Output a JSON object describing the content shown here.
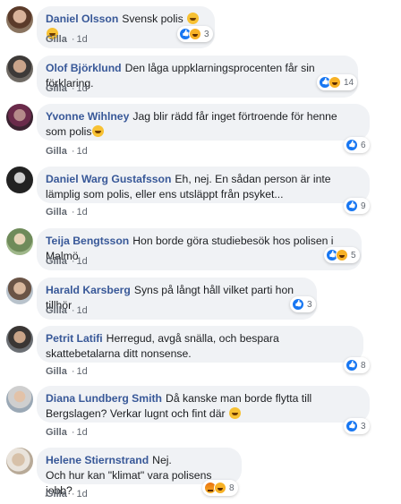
{
  "comments": [
    {
      "author": "Daniel Olsson",
      "text": "Svensk polis",
      "like": "Gilla",
      "time": "1d",
      "reactions": 3,
      "emoji": [
        "haha",
        "haha"
      ],
      "react_icons": [
        "like",
        "haha"
      ]
    },
    {
      "author": "Olof Björklund",
      "text": "Den låga uppklarningsprocenten får sin förklaring.",
      "like": "Gilla",
      "time": "1d",
      "reactions": 14,
      "react_icons": [
        "like",
        "haha"
      ]
    },
    {
      "author": "Yvonne Wihlney",
      "text": "Jag blir rädd får inget förtroende för henne som polis",
      "like": "Gilla",
      "time": "1d",
      "reactions": 6,
      "emoji": [
        "smile"
      ],
      "react_icons": [
        "like"
      ]
    },
    {
      "author": "Daniel Warg Gustafsson",
      "text": "Eh, nej. En sådan person är inte lämplig som polis, eller ens utsläppt från psyket...",
      "like": "Gilla",
      "time": "1d",
      "reactions": 9,
      "react_icons": [
        "like"
      ]
    },
    {
      "author": "Teija Bengtsson",
      "text": "Hon borde göra studiebesök hos polisen i Malmö",
      "like": "Gilla",
      "time": "1d",
      "reactions": 5,
      "react_icons": [
        "like",
        "haha"
      ]
    },
    {
      "author": "Harald Karsberg",
      "text": "Syns på långt håll vilket parti hon tillhör",
      "like": "Gilla",
      "time": "1d",
      "reactions": 3,
      "react_icons": [
        "like"
      ]
    },
    {
      "author": "Petrit Latifi",
      "text": "Herregud, avgå snälla, och bespara skattebetalarna ditt nonsense.",
      "like": "Gilla",
      "time": "1d",
      "reactions": 8,
      "react_icons": [
        "like"
      ]
    },
    {
      "author": "Diana Lundberg Smith",
      "text": "Då kanske man borde flytta till Bergslagen? Verkar lugnt och fint där",
      "like": "Gilla",
      "time": "1d",
      "reactions": 3,
      "emoji": [
        "smile"
      ],
      "react_icons": [
        "like"
      ]
    },
    {
      "author": "Helene Stiernstrand",
      "text": "Nej.",
      "text2": "Och hur kan \"klimat\" vara polisens jobb?",
      "like": "Gilla",
      "time": "1d",
      "reactions": 8,
      "react_icons": [
        "angry",
        "haha"
      ]
    }
  ],
  "colors": {
    "author": "#385898",
    "bubble": "#f0f2f5",
    "like": "#1877f2",
    "haha": "#f7b125"
  }
}
